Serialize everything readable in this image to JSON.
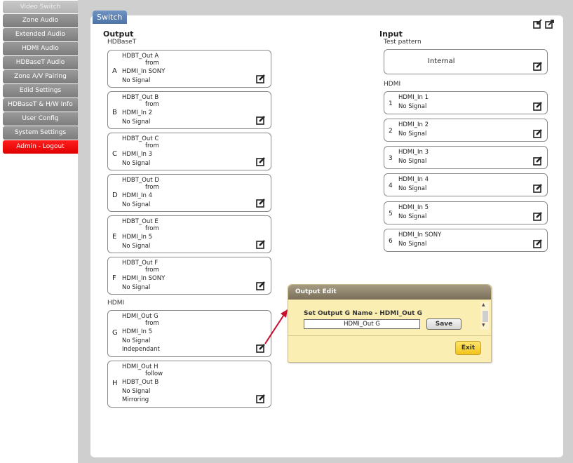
{
  "sidebar": {
    "items": [
      {
        "label": "Video Switch"
      },
      {
        "label": "Zone Audio"
      },
      {
        "label": "Extended Audio"
      },
      {
        "label": "HDMI Audio"
      },
      {
        "label": "HDBaseT Audio"
      },
      {
        "label": "Zone A/V Pairing"
      },
      {
        "label": "Edid Settings"
      },
      {
        "label": "HDBaseT & H/W Info"
      },
      {
        "label": "User Config"
      },
      {
        "label": "System Settings"
      },
      {
        "label": "Admin - Logout"
      }
    ]
  },
  "panel": {
    "tab_label": "Switch"
  },
  "output": {
    "title": "Output",
    "hdbaset_label": "HDBaseT",
    "hdmi_label": "HDMI",
    "cards": [
      {
        "letter": "A",
        "name": "HDBT_Out A",
        "relation": "from",
        "source": "HDMI_In SONY",
        "status": "No Signal"
      },
      {
        "letter": "B",
        "name": "HDBT_Out B",
        "relation": "from",
        "source": "HDMI_In 2",
        "status": "No Signal"
      },
      {
        "letter": "C",
        "name": "HDBT_Out C",
        "relation": "from",
        "source": "HDMI_In 3",
        "status": "No Signal"
      },
      {
        "letter": "D",
        "name": "HDBT_Out D",
        "relation": "from",
        "source": "HDMI_In 4",
        "status": "No Signal"
      },
      {
        "letter": "E",
        "name": "HDBT_Out E",
        "relation": "from",
        "source": "HDMI_In 5",
        "status": "No Signal"
      },
      {
        "letter": "F",
        "name": "HDBT_Out F",
        "relation": "from",
        "source": "HDMI_In SONY",
        "status": "No Signal"
      },
      {
        "letter": "G",
        "name": "HDMI_Out G",
        "relation": "from",
        "source": "HDMI_In 5",
        "status": "No Signal",
        "mode": "Independant"
      },
      {
        "letter": "H",
        "name": "HDMI_Out H",
        "relation": "follow",
        "source": "HDBT_Out B",
        "status": "No Signal",
        "mode": "Mirroring"
      }
    ]
  },
  "input": {
    "title": "Input",
    "test_pattern_label": "Test pattern",
    "test_pattern_value": "Internal",
    "hdmi_label": "HDMI",
    "cards": [
      {
        "num": "1",
        "name": "HDMI_In 1",
        "status": "No Signal"
      },
      {
        "num": "2",
        "name": "HDMI_In 2",
        "status": "No Signal"
      },
      {
        "num": "3",
        "name": "HDMI_In 3",
        "status": "No Signal"
      },
      {
        "num": "4",
        "name": "HDMI_In 4",
        "status": "No Signal"
      },
      {
        "num": "5",
        "name": "HDMI_In 5",
        "status": "No Signal"
      },
      {
        "num": "6",
        "name": "HDMI_In SONY",
        "status": "No Signal"
      }
    ]
  },
  "dialog": {
    "title": "Output Edit",
    "label": "Set Output G Name - HDMI_Out G",
    "input_value": "HDMI_Out G",
    "save_label": "Save",
    "exit_label": "Exit"
  },
  "icons": {
    "edit": "edit-icon",
    "import": "import-icon",
    "export": "export-icon"
  },
  "colors": {
    "tab_blue": "#5a7fb3",
    "logout_red": "#ff0000",
    "arrow_red": "#c8102e",
    "dialog_bg": "#fbeeb3",
    "exit_yellow": "#f2c41a"
  }
}
